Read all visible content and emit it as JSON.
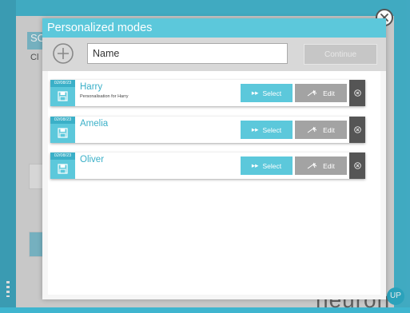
{
  "background": {
    "tag": "SC",
    "tag2": "Cl",
    "logo": "neuron",
    "up_badge": "UP"
  },
  "modal": {
    "title": "Personalized modes",
    "name_placeholder": "Name",
    "continue_label": "Continue",
    "modes": [
      {
        "date": "02/08/23",
        "name": "Harry",
        "description": "Personalisation for Harry",
        "select_label": "Select",
        "edit_label": "Edit"
      },
      {
        "date": "02/08/23",
        "name": "Amelia",
        "description": "",
        "select_label": "Select",
        "edit_label": "Edit"
      },
      {
        "date": "02/08/23",
        "name": "Oliver",
        "description": "",
        "select_label": "Select",
        "edit_label": "Edit"
      }
    ]
  },
  "colors": {
    "accent": "#5cc8db",
    "accent_dark": "#3bb0c8",
    "edit_gray": "#a3a3a3",
    "delete_dark": "#555555"
  }
}
